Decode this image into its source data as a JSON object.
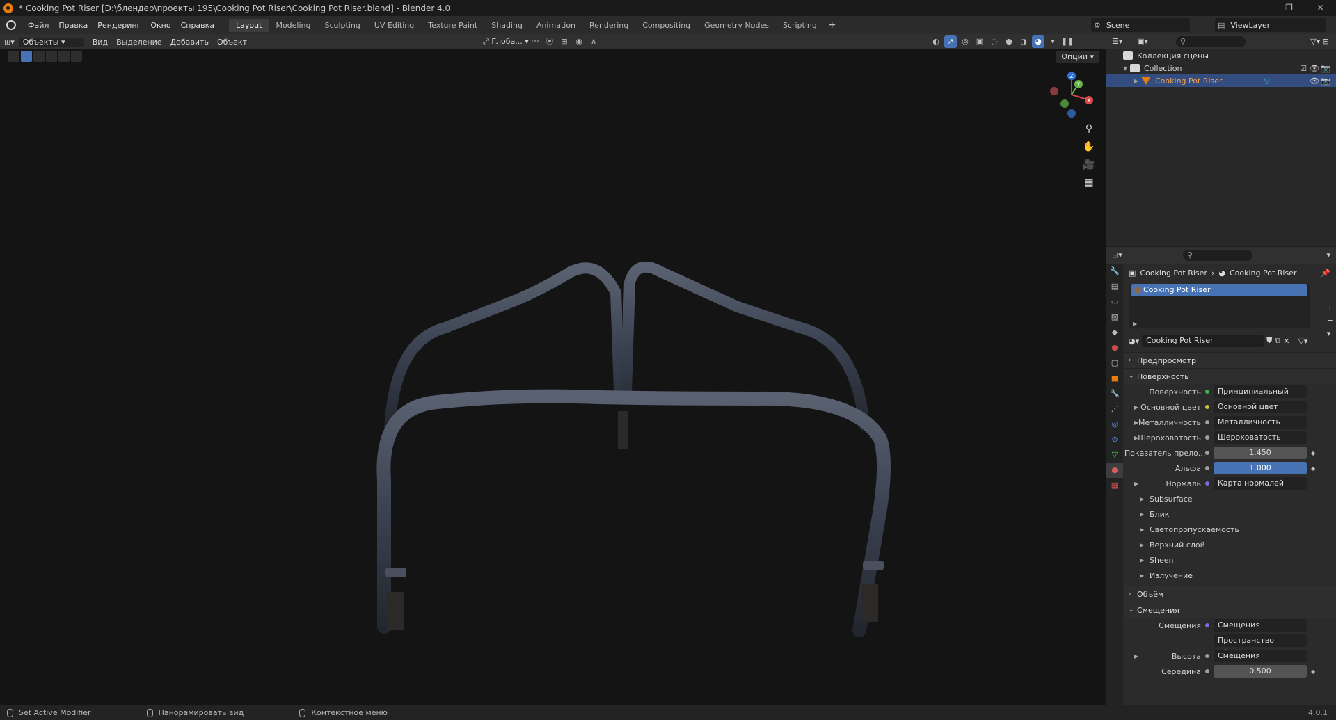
{
  "window": {
    "title": "* Cooking Pot Riser [D:\\блендер\\проекты 195\\Cooking Pot Riser\\Cooking Pot Riser.blend] - Blender 4.0",
    "controls": [
      "—",
      "❐",
      "✕"
    ]
  },
  "menubar": {
    "items": [
      "Файл",
      "Правка",
      "Рендеринг",
      "Окно",
      "Справка"
    ],
    "workspaces": [
      "Layout",
      "Modeling",
      "Sculpting",
      "UV Editing",
      "Texture Paint",
      "Shading",
      "Animation",
      "Rendering",
      "Compositing",
      "Geometry Nodes",
      "Scripting"
    ],
    "active_workspace": "Layout",
    "add": "+",
    "scene": "Scene",
    "view_layer": "ViewLayer"
  },
  "viewport_header": {
    "mode": "Объекты",
    "menus": [
      "Вид",
      "Выделение",
      "Добавить",
      "Объект"
    ],
    "orientation": "Глоба...",
    "options": "Опции"
  },
  "outliner": {
    "root": "Коллекция сцены",
    "collection": "Collection",
    "object": "Cooking Pot Riser"
  },
  "properties": {
    "breadcrumb": [
      "Cooking Pot Riser",
      "Cooking Pot Riser"
    ],
    "slot": "Cooking Pot Riser",
    "material_name": "Cooking Pot Riser",
    "sections": {
      "preview": "Предпросмотр",
      "surface": "Поверхность",
      "volume": "Объём",
      "displacement": "Смещения"
    },
    "surface_rows": [
      {
        "label": "Поверхность",
        "value": "Принципиальный BSDF",
        "dot": "#3fb54b"
      },
      {
        "label": "Основной цвет",
        "value": "Основной цвет",
        "dot": "#c8c83c"
      },
      {
        "label": "Металличность",
        "value": "Металличность",
        "dot": "#a0a0a0"
      },
      {
        "label": "Шероховатость",
        "value": "Шероховатость",
        "dot": "#a0a0a0"
      },
      {
        "label": "Показатель прело...",
        "value": "1.450",
        "dot": "#a0a0a0"
      },
      {
        "label": "Альфа",
        "value": "1.000",
        "dot": "#a0a0a0"
      },
      {
        "label": "Нормаль",
        "value": "Карта нормалей",
        "dot": "#7a6cd8"
      }
    ],
    "subsections": [
      "Subsurface",
      "Блик",
      "Светопропускаемость",
      "Верхний слой",
      "Sheen",
      "Излучение"
    ],
    "disp_rows": [
      {
        "label": "Смещения",
        "value": "Смещения",
        "dot": "#7a6cd8"
      },
      {
        "label": "",
        "value": "Пространство объекта",
        "dot": ""
      },
      {
        "label": "Высота",
        "value": "Смещения",
        "dot": "#a0a0a0"
      },
      {
        "label": "Середина",
        "value": "0.500",
        "dot": "#a0a0a0"
      }
    ]
  },
  "statusbar": {
    "items": [
      "Set Active Modifier",
      "Панорамировать вид",
      "Контекстное меню"
    ],
    "version": "4.0.1"
  },
  "colors": {
    "accent": "#4772b3",
    "object_orange": "#e87d0d",
    "viewport_bg": "#141414"
  }
}
